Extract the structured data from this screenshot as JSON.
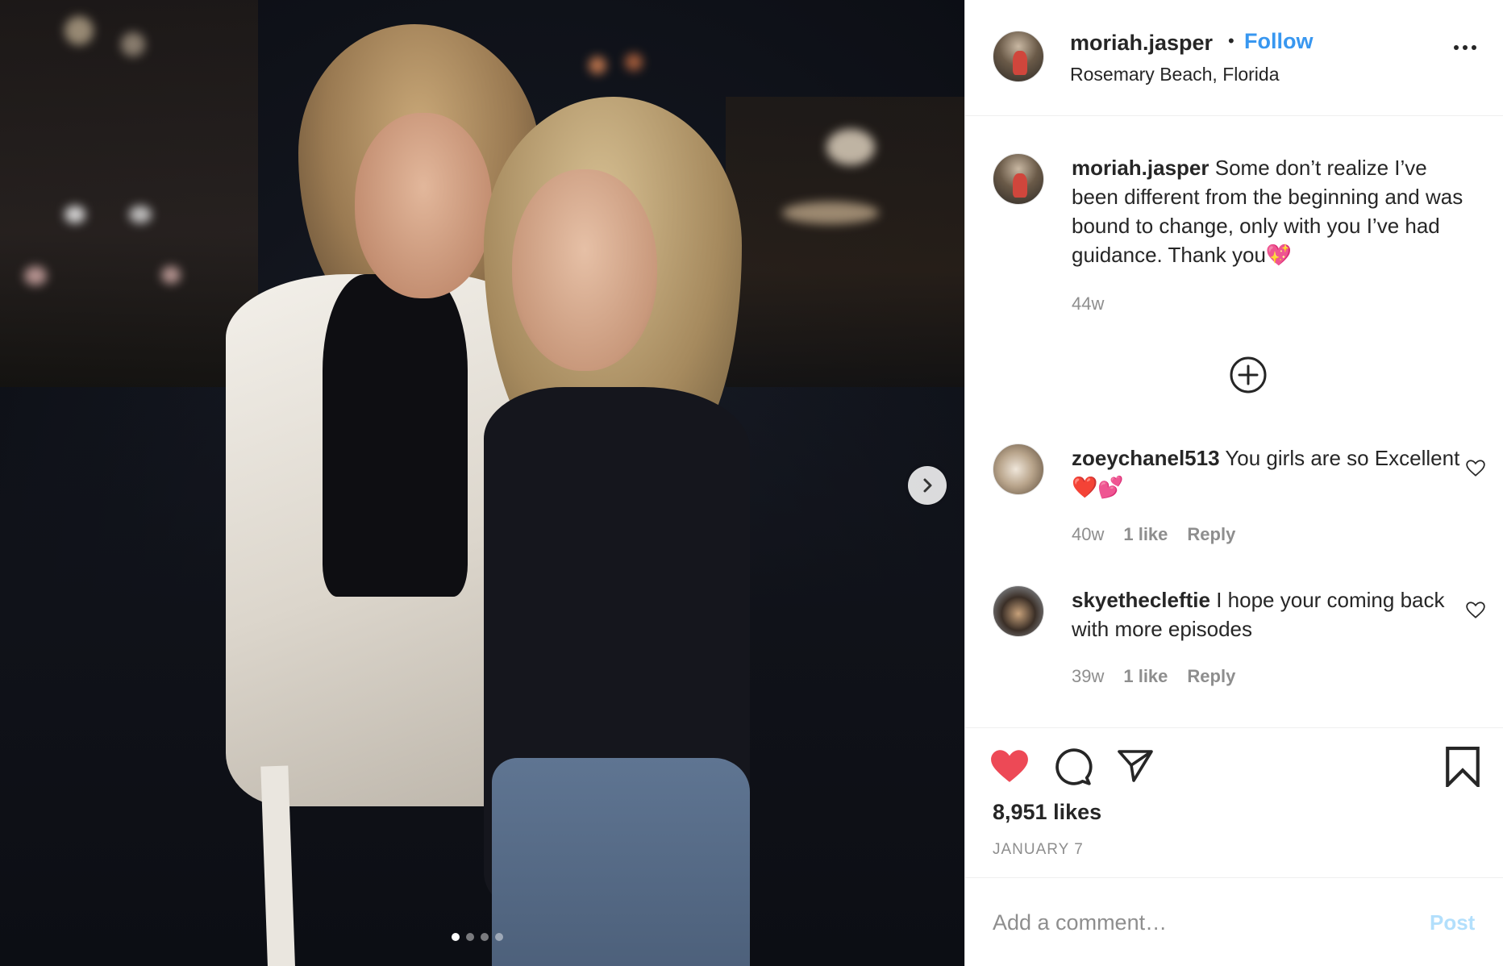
{
  "post": {
    "username": "moriah.jasper",
    "follow_label": "Follow",
    "location": "Rosemary Beach, Florida",
    "caption": "Some don’t realize I’ve been different from the beginning and was bound to change, only with you I’ve had guidance. Thank you💖",
    "caption_age": "44w",
    "likes": "8,951 likes",
    "date": "JANUARY 7",
    "carousel": {
      "count": 4,
      "active": 0
    }
  },
  "comments": [
    {
      "username": "zoeychanel513",
      "text": "You girls are so Excellent ❤️💕",
      "age": "40w",
      "likes": "1 like",
      "reply": "Reply"
    },
    {
      "username": "skyethecleftie",
      "text": "I hope your coming back with more episodes",
      "age": "39w",
      "likes": "1 like",
      "reply": "Reply"
    }
  ],
  "composer": {
    "placeholder": "Add a comment…",
    "post_label": "Post"
  },
  "icons": {
    "like": "heart-filled-icon",
    "comment": "comment-bubble-icon",
    "share": "paper-plane-icon",
    "save": "bookmark-icon",
    "more": "more-dots-icon",
    "next": "chevron-right-icon",
    "load_more": "plus-circle-icon"
  },
  "colors": {
    "accent": "#3897f0",
    "like_red": "#ed4956",
    "muted": "#8e8e8e",
    "post_disabled": "#b2dffc"
  }
}
